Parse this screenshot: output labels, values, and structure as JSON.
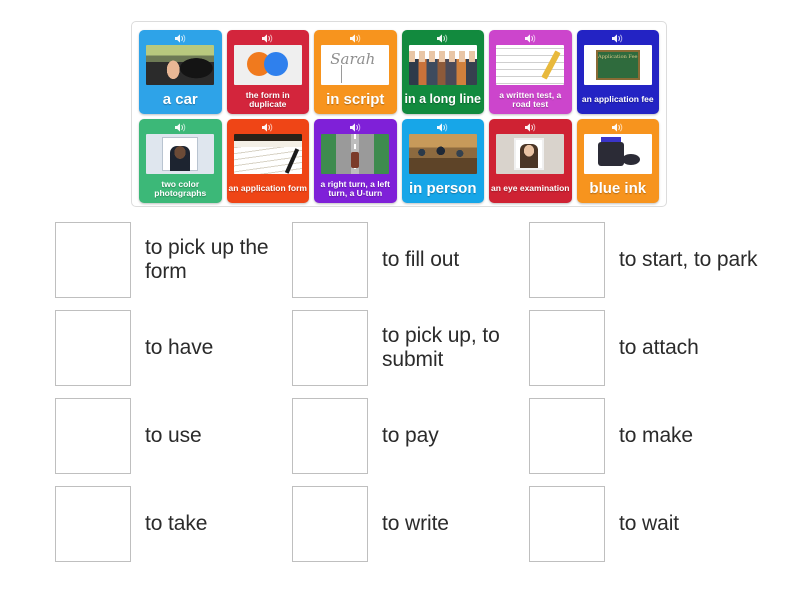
{
  "cards": [
    {
      "label": "a car",
      "color": "#2ea3e8",
      "size": "big",
      "thumb": "t-driving",
      "icon": "speaker-icon"
    },
    {
      "label": "the form in duplicate",
      "color": "#d3253c",
      "size": "small",
      "thumb": "t-duplicate",
      "icon": "speaker-icon"
    },
    {
      "label": "in script",
      "color": "#f7941e",
      "size": "big",
      "thumb": "t-script",
      "icon": "speaker-icon"
    },
    {
      "label": "in a long line",
      "color": "#128a3e",
      "size": "mid",
      "thumb": "t-line",
      "icon": "speaker-icon"
    },
    {
      "label": "a written test, a road test",
      "color": "#cc45cc",
      "size": "small",
      "thumb": "t-writtentest",
      "icon": "speaker-icon"
    },
    {
      "label": "an application fee",
      "color": "#2323c4",
      "size": "small",
      "thumb": "t-fee",
      "icon": "speaker-icon"
    },
    {
      "label": "two color photographs",
      "color": "#3cb878",
      "size": "small",
      "thumb": "t-photos",
      "icon": "speaker-icon"
    },
    {
      "label": "an application form",
      "color": "#ef4516",
      "size": "small",
      "thumb": "t-appform",
      "icon": "speaker-icon"
    },
    {
      "label": "a right turn, a left turn, a U-turn",
      "color": "#7f20d8",
      "size": "small",
      "thumb": "t-turns",
      "icon": "speaker-icon"
    },
    {
      "label": "in person",
      "color": "#17a6e8",
      "size": "big",
      "thumb": "t-inperson",
      "icon": "speaker-icon"
    },
    {
      "label": "an eye examination",
      "color": "#cf2233",
      "size": "small",
      "thumb": "t-eye",
      "icon": "speaker-icon"
    },
    {
      "label": "blue ink",
      "color": "#f7941e",
      "size": "big",
      "thumb": "t-ink",
      "icon": "speaker-icon"
    }
  ],
  "answers": [
    {
      "text": "to pick up the form",
      "placeholder": ""
    },
    {
      "text": "to fill out",
      "placeholder": ""
    },
    {
      "text": "to start, to park",
      "placeholder": ""
    },
    {
      "text": "to have",
      "placeholder": ""
    },
    {
      "text": "to pick up, to submit",
      "placeholder": ""
    },
    {
      "text": "to attach",
      "placeholder": ""
    },
    {
      "text": "to use",
      "placeholder": ""
    },
    {
      "text": "to pay",
      "placeholder": ""
    },
    {
      "text": "to make",
      "placeholder": ""
    },
    {
      "text": "to take",
      "placeholder": ""
    },
    {
      "text": "to write",
      "placeholder": ""
    },
    {
      "text": "to wait",
      "placeholder": ""
    }
  ],
  "colors": {
    "page_background": "#ffffff",
    "tray_border": "#dcdcdc",
    "drop_box_border": "#bfbfbf",
    "answer_text": "#2b2b2b"
  }
}
